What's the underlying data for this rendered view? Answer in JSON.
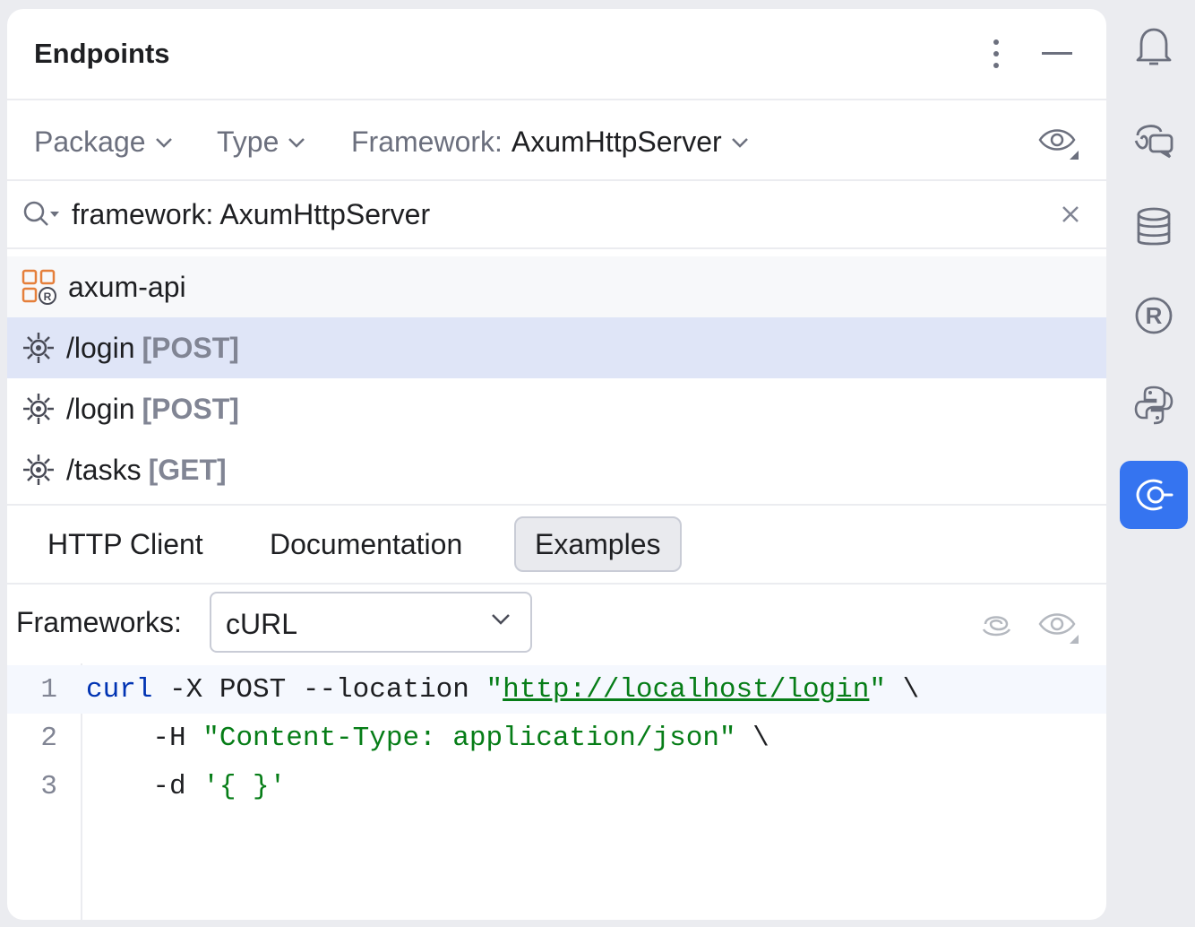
{
  "panel": {
    "title": "Endpoints"
  },
  "filters": {
    "package": "Package",
    "type": "Type",
    "framework_label": "Framework:",
    "framework_value": "AxumHttpServer"
  },
  "search": {
    "value": "framework: AxumHttpServer"
  },
  "tree": {
    "group": "axum-api",
    "endpoints": [
      {
        "path": "/login",
        "method": "[POST]",
        "selected": true
      },
      {
        "path": "/login",
        "method": "[POST]",
        "selected": false
      },
      {
        "path": "/tasks",
        "method": "[GET]",
        "selected": false
      }
    ]
  },
  "tabs": [
    {
      "label": "HTTP Client",
      "active": false
    },
    {
      "label": "Documentation",
      "active": false
    },
    {
      "label": "Examples",
      "active": true
    }
  ],
  "frameworks": {
    "label": "Frameworks:",
    "selected": "cURL"
  },
  "editor": {
    "line_numbers": [
      "1",
      "2",
      "3"
    ],
    "lines": [
      {
        "parts": [
          "curl",
          " -X POST --location ",
          "\"",
          "http://localhost/login",
          "\"",
          " \\"
        ]
      },
      {
        "parts": [
          "    -H ",
          "\"Content-Type: application/json\"",
          " \\"
        ]
      },
      {
        "parts": [
          "    -d ",
          "'{ }'"
        ]
      }
    ]
  },
  "sidebar": {
    "icons": [
      "bell-icon",
      "ai-chat-icon",
      "database-icon",
      "rust-icon",
      "python-icon",
      "endpoints-icon"
    ],
    "active": "endpoints-icon"
  },
  "colors": {
    "accent": "#3574f0",
    "selection": "#dfe5f7",
    "keyword": "#0033b3",
    "string": "#067d17"
  }
}
